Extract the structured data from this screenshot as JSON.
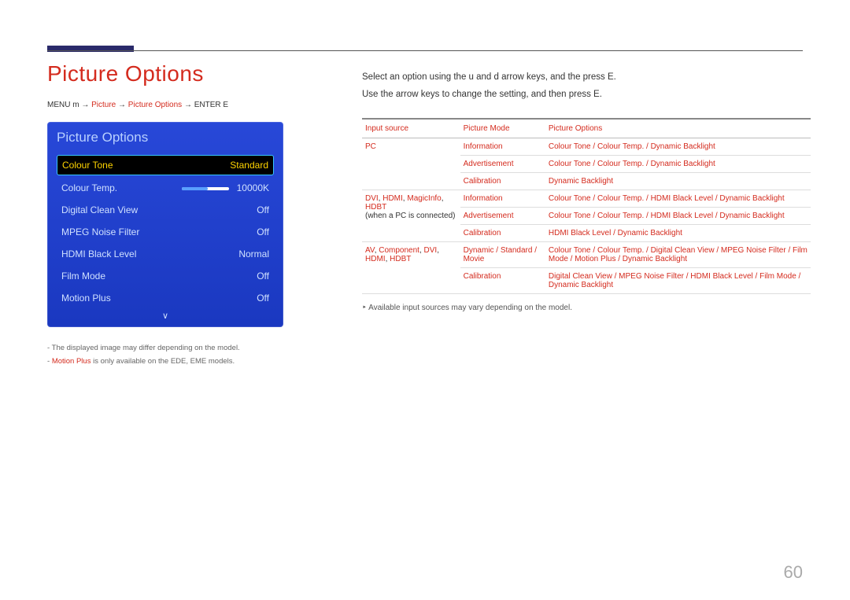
{
  "page_number": "60",
  "title": "Picture Options",
  "menupath": {
    "prefix": "MENU m → ",
    "p1": "Picture",
    "arrow1": " → ",
    "p2": "Picture Options",
    "arrow2": " → ",
    "suffix": "ENTER E"
  },
  "osd": {
    "heading": "Picture Options",
    "rows": [
      {
        "label": "Colour Tone",
        "value": "Standard",
        "selected": true
      },
      {
        "label": "Colour Temp.",
        "value": "10000K",
        "slider": true
      },
      {
        "label": "Digital Clean View",
        "value": "Off"
      },
      {
        "label": "MPEG Noise Filter",
        "value": "Off"
      },
      {
        "label": "HDMI Black Level",
        "value": "Normal"
      },
      {
        "label": "Film Mode",
        "value": "Off"
      },
      {
        "label": "Motion Plus",
        "value": "Off"
      }
    ],
    "chevron": "∨"
  },
  "notes": {
    "n1_pre": "- ",
    "n1": "The displayed image may differ depending on the model.",
    "n2_pre": "- ",
    "n2_hl": "Motion Plus",
    "n2_tail": " is only available on the EDE, EME models."
  },
  "instructions": {
    "l1": "Select an option using the u and d arrow keys, and the press E.",
    "l2": "Use the arrow keys to change the setting, and then press E."
  },
  "table": {
    "h1": "Input source",
    "h2": "Picture Mode",
    "h3": "Picture Options",
    "rows": [
      {
        "c1": {
          "hl": "PC"
        },
        "c2": {
          "hl": "Information"
        },
        "c3": {
          "hl": "Colour Tone / Colour Temp. / Dynamic Backlight"
        }
      },
      {
        "c1": {
          "text": ""
        },
        "c2": {
          "hl": "Advertisement"
        },
        "c3": {
          "hl": "Colour Tone / Colour Temp. / Dynamic Backlight"
        }
      },
      {
        "c1": {
          "text": ""
        },
        "c2": {
          "hl": "Calibration"
        },
        "c3": {
          "hl": "Dynamic Backlight"
        }
      },
      {
        "c1": {
          "hl": "DVI",
          "text": ", ",
          "hl2": "HDMI",
          "text2": ", ",
          "hl3": "MagicInfo",
          "text3": ", ",
          "hl4": "HDBT",
          "sub": "(when a PC is connected)"
        },
        "c2": {
          "hl": "Information"
        },
        "c3": {
          "hl": "Colour Tone / Colour Temp. / HDMI Black Level / Dynamic Backlight"
        }
      },
      {
        "c1": {
          "text": ""
        },
        "c2": {
          "hl": "Advertisement"
        },
        "c3": {
          "hl": "Colour Tone / Colour Temp. / HDMI Black Level / Dynamic Backlight"
        }
      },
      {
        "c1": {
          "text": ""
        },
        "c2": {
          "hl": "Calibration"
        },
        "c3": {
          "hl": "HDMI Black Level / Dynamic Backlight"
        }
      },
      {
        "c1": {
          "hl": "AV",
          "text": ", ",
          "hl2": "Component",
          "text2": ", ",
          "hl3": "DVI",
          "text3": ", ",
          "hl4": "HDMI",
          "text4": ", ",
          "hl5": "HDBT"
        },
        "c2": {
          "hl": "Dynamic / Standard / Movie"
        },
        "c3": {
          "hl": "Colour Tone / Colour Temp. / Digital Clean View / MPEG Noise Filter / Film Mode / Motion Plus / Dynamic Backlight"
        }
      },
      {
        "c1": {
          "text": ""
        },
        "c2": {
          "hl": "Calibration"
        },
        "c3": {
          "hl": "Digital Clean View / MPEG Noise Filter / HDMI Black Level / Film Mode / Dynamic Backlight"
        }
      }
    ]
  },
  "footnote": "Available input sources may vary depending on the model."
}
